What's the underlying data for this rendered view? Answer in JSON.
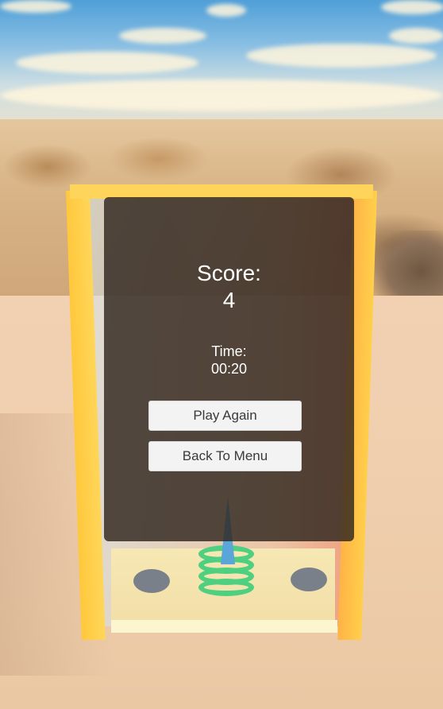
{
  "game_over_panel": {
    "score_label": "Score:",
    "score_value": "4",
    "time_label": "Time:",
    "time_value": "00:20",
    "play_again_label": "Play Again",
    "back_to_menu_label": "Back To Menu"
  },
  "colors": {
    "panel_background": "#30261ed1",
    "button_background": "#f3f3f3",
    "button_text": "#3a3a3a",
    "cabinet_frame": "#ffc83c",
    "ring": "#4fcf80",
    "peg": "#5aa6d8"
  }
}
